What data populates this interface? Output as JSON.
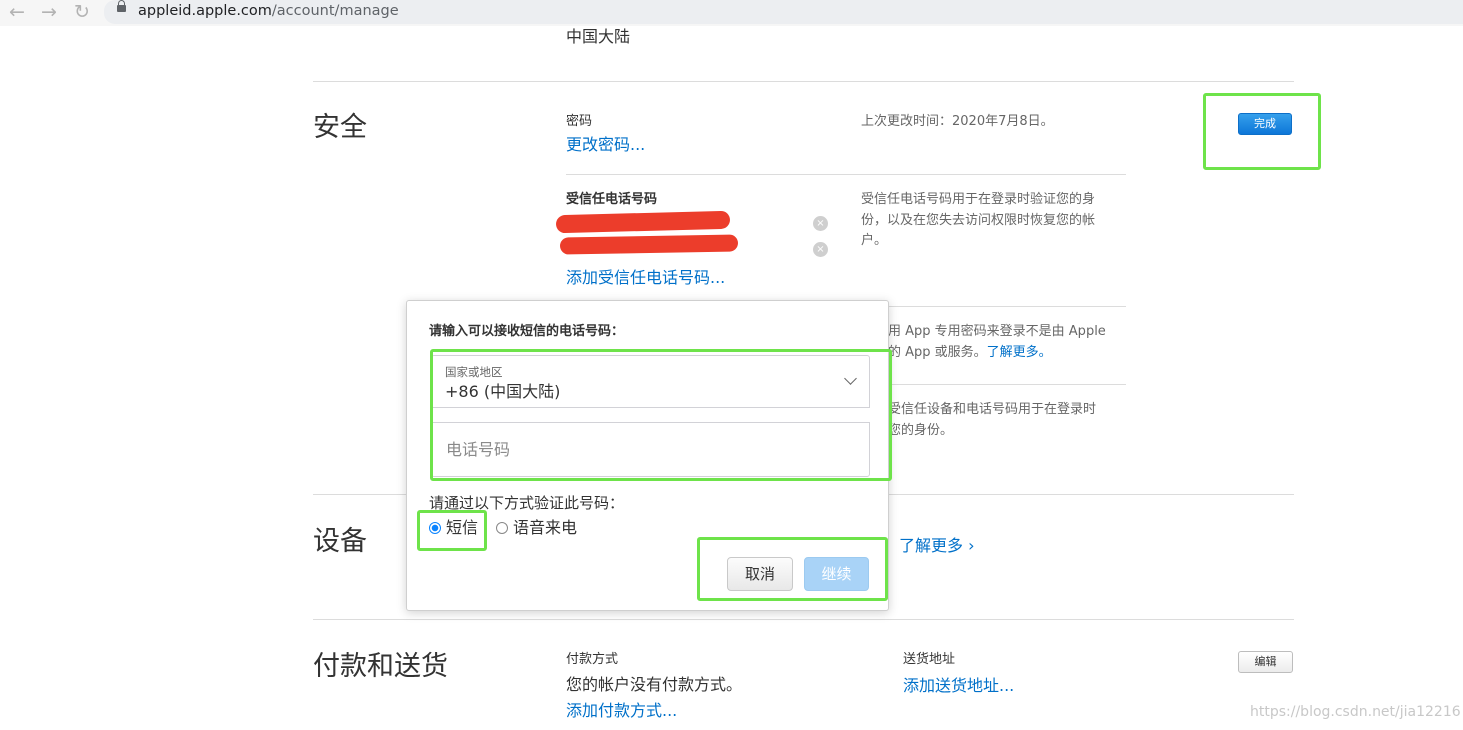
{
  "browser": {
    "back_glyph": "←",
    "forward_glyph": "→",
    "reload_glyph": "↻",
    "url_host": "appleid.apple.com",
    "url_path": "/account/manage"
  },
  "region_value": "中国大陆",
  "security": {
    "title": "安全",
    "password_label": "密码",
    "change_password_link": "更改密码...",
    "last_changed": "上次更改时间：2020年7月8日。",
    "done_button": "完成",
    "trusted_label": "受信任电话号码",
    "add_trusted_link": "添加受信任电话号码...",
    "trusted_desc": "受信任电话号码用于在登录时验证您的身份，以及在您失去访问权限时恢复您的帐户。",
    "remove_glyph": "×",
    "app_pw_desc_a": "用 App 专用密码来登录不是由 Apple",
    "app_pw_desc_b": "的 App 或服务。",
    "app_pw_link": "了解更多。",
    "devices_desc_a": "受信任设备和电话号码用于在登录时",
    "devices_desc_b": "您的身份。"
  },
  "dialog": {
    "prompt": "请输入可以接收短信的电话号码：",
    "country_caption": "国家或地区",
    "country_value": "+86 (中国大陆)",
    "phone_placeholder": "电话号码",
    "verify_prompt": "请通过以下方式验证此号码：",
    "option_sms": "短信",
    "option_voice": "语音来电",
    "cancel_button": "取消",
    "continue_button": "继续"
  },
  "devices": {
    "title": "设备",
    "learn_more_link": "了解更多 ›"
  },
  "payment": {
    "title": "付款和送货",
    "method_label": "付款方式",
    "no_method_text": "您的帐户没有付款方式。",
    "add_method_link": "添加付款方式...",
    "shipping_label": "送货地址",
    "add_shipping_link": "添加送货地址...",
    "edit_button": "编辑"
  },
  "watermark": "https://blog.csdn.net/jia12216",
  "colors": {
    "link": "#0070c9",
    "primary_button": "#0d76d8",
    "highlight_box": "#6ee34a",
    "redaction": "#ec3d2b"
  }
}
